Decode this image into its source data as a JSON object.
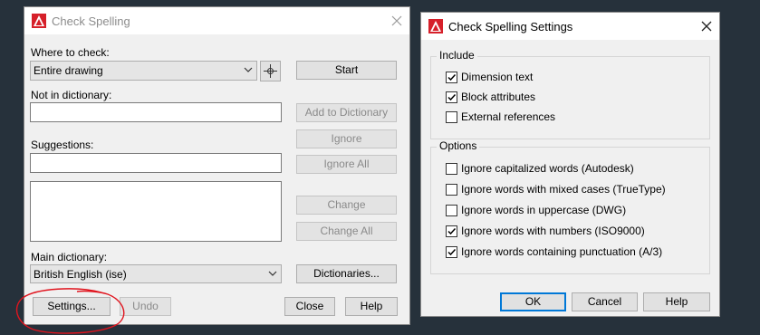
{
  "check_spelling": {
    "title": "Check Spelling",
    "where_label": "Where to check:",
    "where_value": "Entire drawing",
    "not_in_dict_label": "Not in dictionary:",
    "not_in_dict_value": "",
    "suggestions_label": "Suggestions:",
    "suggestion_value": "",
    "main_dict_label": "Main dictionary:",
    "main_dict_value": "British English (ise)",
    "buttons": {
      "start": "Start",
      "add_to_dictionary": "Add to Dictionary",
      "ignore": "Ignore",
      "ignore_all": "Ignore All",
      "change": "Change",
      "change_all": "Change All",
      "dictionaries": "Dictionaries...",
      "settings": "Settings...",
      "undo": "Undo",
      "close": "Close",
      "help": "Help"
    }
  },
  "settings_dialog": {
    "title": "Check Spelling Settings",
    "include": {
      "title": "Include",
      "items": [
        {
          "label": "Dimension text",
          "checked": true
        },
        {
          "label": "Block attributes",
          "checked": true
        },
        {
          "label": "External references",
          "checked": false
        }
      ]
    },
    "options": {
      "title": "Options",
      "items": [
        {
          "label": "Ignore capitalized words (Autodesk)",
          "checked": false
        },
        {
          "label": "Ignore words with mixed cases (TrueType)",
          "checked": false
        },
        {
          "label": "Ignore words in uppercase (DWG)",
          "checked": false
        },
        {
          "label": "Ignore words with numbers (ISO9000)",
          "checked": true
        },
        {
          "label": "Ignore words containing punctuation (A/3)",
          "checked": true
        }
      ]
    },
    "buttons": {
      "ok": "OK",
      "cancel": "Cancel",
      "help": "Help"
    }
  },
  "colors": {
    "app_icon": "#d6202a",
    "focus_border": "#0078d7",
    "annotation": "#e0141e",
    "background": "#26313b"
  }
}
